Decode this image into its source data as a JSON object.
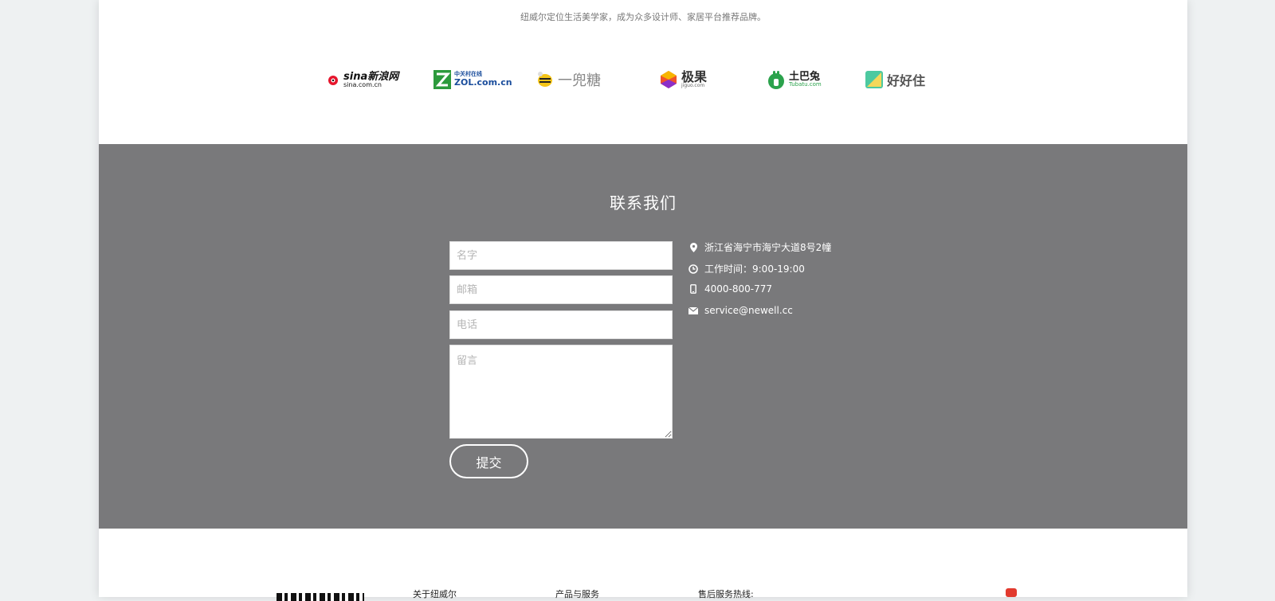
{
  "tagline": "纽威尔定位生活美学家，成为众多设计师、家居平台推荐品牌。",
  "partners": [
    {
      "name": "sina",
      "main": "sina新浪网",
      "sub": "sina.com.cn",
      "color": "#111111"
    },
    {
      "name": "zol",
      "main": "中关村在线",
      "sub": "ZOL.com.cn",
      "color": "#1a4d9c"
    },
    {
      "name": "yidoutang",
      "main": "一兜糖",
      "sub": "",
      "color": "#888888"
    },
    {
      "name": "jiguo",
      "main": "极果",
      "sub": "jiguo.com",
      "color": "#333333"
    },
    {
      "name": "tubatu",
      "main": "土巴兔",
      "sub": "Tubatu.com",
      "color": "#2ba24c"
    },
    {
      "name": "haohaozhu",
      "main": "好好住",
      "sub": "",
      "color": "#555555"
    }
  ],
  "contact": {
    "title": "联系我们",
    "form": {
      "name_placeholder": "名字",
      "email_placeholder": "邮箱",
      "phone_placeholder": "电话",
      "message_placeholder": "留言",
      "submit_label": "提交"
    },
    "info": {
      "address": "浙江省海宁市海宁大道8号2幢",
      "hours": "工作时间：9:00-19:00",
      "phone": "4000-800-777",
      "email": "service@newell.cc"
    }
  },
  "footer": {
    "about": "关于纽威尔",
    "products": "产品与服务",
    "hotline": "售后服务热线:"
  },
  "colors": {
    "contact_bg": "#79797b",
    "page_bg": "#eef1f2"
  }
}
